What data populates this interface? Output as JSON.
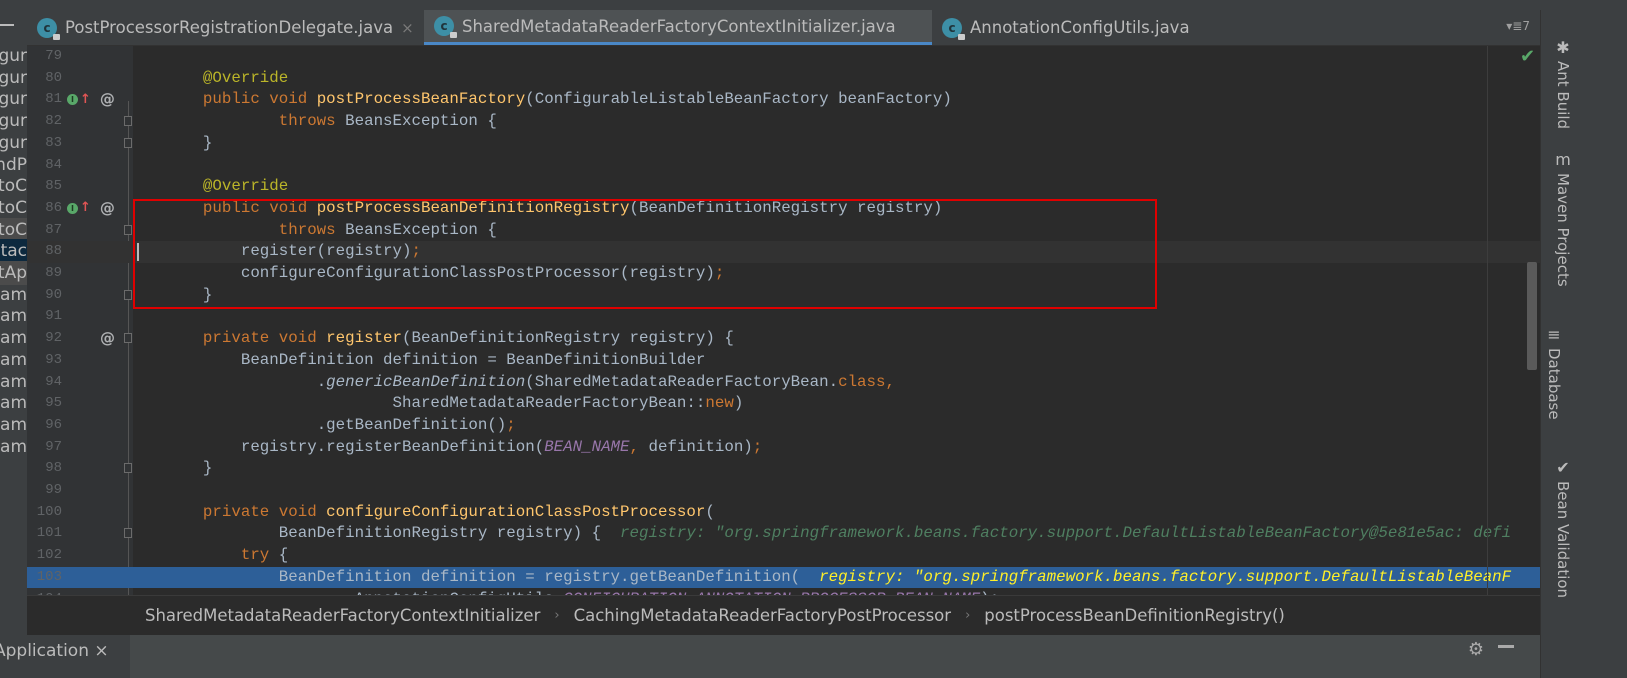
{
  "left_panel": {
    "items": [
      {
        "label": "Configur",
        "state": ""
      },
      {
        "label": "Configur",
        "state": ""
      },
      {
        "label": "Configur",
        "state": ""
      },
      {
        "label": "Configur",
        "state": ""
      },
      {
        "label": "Configur",
        "state": ""
      },
      {
        "label": "AndP",
        "state": ""
      },
      {
        "label": "AutoC",
        "state": ""
      },
      {
        "label": "AutoC",
        "state": ""
      },
      {
        "label": "AutoC",
        "state": "hl"
      },
      {
        "label": "Metac",
        "state": "sel"
      },
      {
        "label": "BootAp",
        "state": "hl"
      },
      {
        "label": "Exam",
        "state": ""
      },
      {
        "label": "Exam",
        "state": ""
      },
      {
        "label": "Exam",
        "state": ""
      },
      {
        "label": "Exam",
        "state": ""
      },
      {
        "label": "Exam",
        "state": ""
      },
      {
        "label": "Exam",
        "state": ""
      },
      {
        "label": "Exam",
        "state": ""
      },
      {
        "label": "Exam",
        "state": ""
      }
    ]
  },
  "tabs": [
    {
      "label": "PostProcessorRegistrationDelegate.java",
      "icon": "class-locked-icon",
      "active": false,
      "close": "×"
    },
    {
      "label": "SharedMetadataReaderFactoryContextInitializer.java",
      "icon": "class-locked-icon",
      "active": true,
      "close": ""
    },
    {
      "label": "AnnotationConfigUtils.java",
      "icon": "class-locked-icon",
      "active": false,
      "close": ""
    }
  ],
  "tab_count": "▾≣7",
  "editor": {
    "caret_line": 88,
    "exec_line": 103,
    "lines": [
      {
        "n": "79",
        "tokens": []
      },
      {
        "n": "80",
        "tokens": [
          [
            "    ",
            ""
          ],
          [
            "@Override",
            "a"
          ]
        ]
      },
      {
        "n": "81",
        "gutter": "implements-override",
        "tokens": [
          [
            "    ",
            ""
          ],
          [
            "public void ",
            "k"
          ],
          [
            "postProcessBeanFactory",
            "f"
          ],
          [
            "(ConfigurableListableBeanFactory beanFactory)",
            "t"
          ]
        ]
      },
      {
        "n": "82",
        "fold": true,
        "tokens": [
          [
            "            ",
            ""
          ],
          [
            "throws ",
            "k"
          ],
          [
            "BeansException {",
            "t"
          ]
        ]
      },
      {
        "n": "83",
        "fold": true,
        "tokens": [
          [
            "    ",
            ""
          ],
          [
            "}",
            "t"
          ]
        ]
      },
      {
        "n": "84",
        "tokens": []
      },
      {
        "n": "85",
        "tokens": [
          [
            "    ",
            ""
          ],
          [
            "@Override",
            "a"
          ]
        ]
      },
      {
        "n": "86",
        "gutter": "implements-override",
        "tokens": [
          [
            "    ",
            ""
          ],
          [
            "public void ",
            "k"
          ],
          [
            "postProcessBeanDefinitionRegistry",
            "f"
          ],
          [
            "(BeanDefinitionRegistry registry)",
            "t"
          ]
        ]
      },
      {
        "n": "87",
        "fold": true,
        "tokens": [
          [
            "            ",
            ""
          ],
          [
            "throws ",
            "k"
          ],
          [
            "BeansException {",
            "t"
          ]
        ]
      },
      {
        "n": "88",
        "tokens": [
          [
            "        ",
            ""
          ],
          [
            "register(registry)",
            "t"
          ],
          [
            ";",
            "k"
          ]
        ]
      },
      {
        "n": "89",
        "tokens": [
          [
            "        ",
            ""
          ],
          [
            "configureConfigurationClassPostProcessor(registry)",
            "t"
          ],
          [
            ";",
            "k"
          ]
        ]
      },
      {
        "n": "90",
        "fold": true,
        "tokens": [
          [
            "    ",
            ""
          ],
          [
            "}",
            "t"
          ]
        ]
      },
      {
        "n": "91",
        "tokens": []
      },
      {
        "n": "92",
        "gutter": "override",
        "fold": true,
        "tokens": [
          [
            "    ",
            ""
          ],
          [
            "private void ",
            "k"
          ],
          [
            "register",
            "f"
          ],
          [
            "(BeanDefinitionRegistry registry) {",
            "t"
          ]
        ]
      },
      {
        "n": "93",
        "tokens": [
          [
            "        ",
            ""
          ],
          [
            "BeanDefinition definition = BeanDefinitionBuilder",
            "t"
          ]
        ]
      },
      {
        "n": "94",
        "tokens": [
          [
            "                ",
            ""
          ],
          [
            ".",
            "t"
          ],
          [
            "genericBeanDefinition",
            "i"
          ],
          [
            "(SharedMetadataReaderFactoryBean.",
            "t"
          ],
          [
            "class,",
            "k"
          ]
        ]
      },
      {
        "n": "95",
        "tokens": [
          [
            "                        ",
            ""
          ],
          [
            "SharedMetadataReaderFactoryBean::",
            "t"
          ],
          [
            "new",
            "k"
          ],
          [
            ")",
            "t"
          ]
        ]
      },
      {
        "n": "96",
        "tokens": [
          [
            "                ",
            ""
          ],
          [
            ".getBeanDefinition()",
            "t"
          ],
          [
            ";",
            "k"
          ]
        ]
      },
      {
        "n": "97",
        "tokens": [
          [
            "        ",
            ""
          ],
          [
            "registry.registerBeanDefinition(",
            "t"
          ],
          [
            "BEAN_NAME",
            "c"
          ],
          [
            ", ",
            "k"
          ],
          [
            "definition)",
            "t"
          ],
          [
            ";",
            "k"
          ]
        ]
      },
      {
        "n": "98",
        "fold": true,
        "tokens": [
          [
            "    ",
            ""
          ],
          [
            "}",
            "t"
          ]
        ]
      },
      {
        "n": "99",
        "tokens": []
      },
      {
        "n": "100",
        "tokens": [
          [
            "    ",
            ""
          ],
          [
            "private void ",
            "k"
          ],
          [
            "configureConfigurationClassPostProcessor",
            "f"
          ],
          [
            "(",
            "t"
          ]
        ]
      },
      {
        "n": "101",
        "fold": true,
        "tokens": [
          [
            "            ",
            ""
          ],
          [
            "BeanDefinitionRegistry registry) {",
            "t"
          ],
          [
            "  registry: \"org.springframework.beans.factory.support.DefaultListableBeanFactory@5e81e5ac: defi",
            "h"
          ]
        ]
      },
      {
        "n": "102",
        "tokens": [
          [
            "        ",
            ""
          ],
          [
            "try ",
            "k"
          ],
          [
            "{",
            "t"
          ]
        ]
      },
      {
        "n": "103",
        "tokens": [
          [
            "            ",
            ""
          ],
          [
            "BeanDefinition definition = registry.getBeanDefinition(",
            "t"
          ],
          [
            "  registry: \"org.springframework.beans.factory.support.DefaultListableBeanF",
            "hy"
          ]
        ]
      },
      {
        "n": "104",
        "tokens": [
          [
            "                    ",
            ""
          ],
          [
            "AnnotationConfigUtils.",
            "t"
          ],
          [
            "CONFIGURATION_ANNOTATION_PROCESSOR_BEAN_NAME",
            "c"
          ],
          [
            ");",
            "t"
          ]
        ]
      }
    ]
  },
  "breadcrumb": [
    "SharedMetadataReaderFactoryContextInitializer",
    "CachingMetadataReaderFactoryPostProcessor",
    "postProcessBeanDefinitionRegistry()"
  ],
  "breadcrumb_sep": "›",
  "bottom": {
    "run_tab": "Application ×"
  },
  "right_tools": [
    {
      "label": "Ant Build",
      "icon": "ant-icon",
      "glyph": "✱"
    },
    {
      "label": "Maven Projects",
      "icon": "maven-icon",
      "glyph": "m"
    },
    {
      "label": "Database",
      "icon": "database-icon",
      "glyph": "≡"
    },
    {
      "label": "Bean Validation",
      "icon": "bean-validation-icon",
      "glyph": "✔"
    }
  ],
  "colors": {
    "keyword": "#cc7832",
    "method": "#ffc66d",
    "annotation": "#bbb529",
    "exec_line": "#2d5f98",
    "highlight_box": "#e00000",
    "hint": "#4f7f61",
    "hint_exec": "#ffef28"
  }
}
